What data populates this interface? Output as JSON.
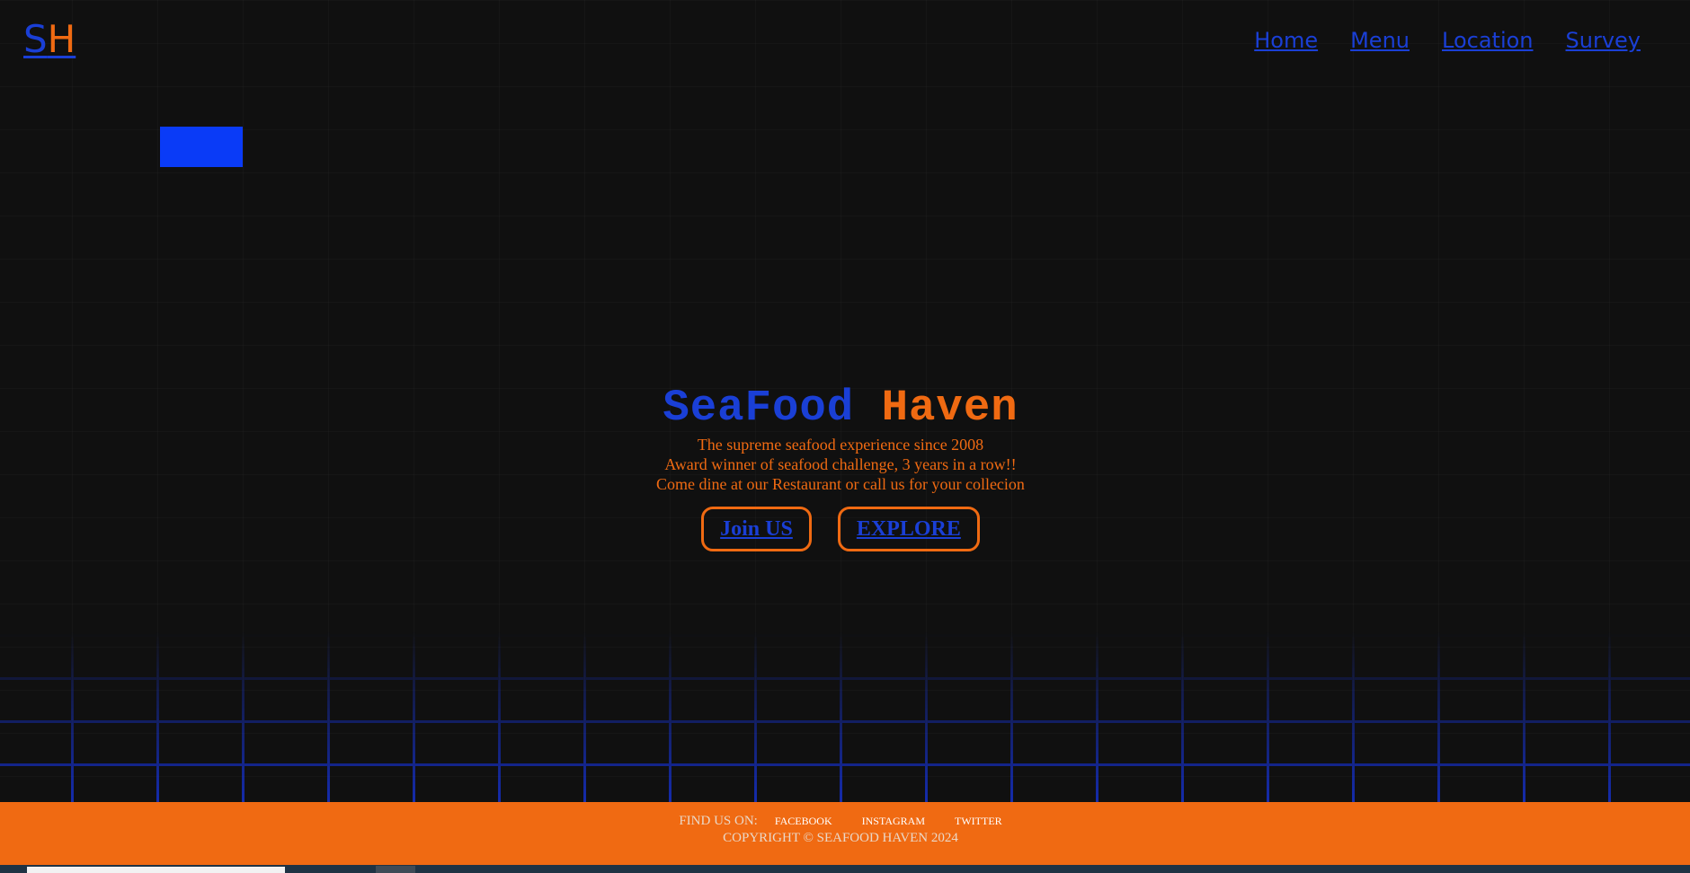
{
  "header": {
    "logo_s": "S",
    "logo_h": "H",
    "nav": [
      "Home",
      "Menu",
      "Location",
      "Survey"
    ]
  },
  "hero": {
    "title_part1": "SeaFood",
    "title_part2": "Haven",
    "taglines": [
      "The supreme seafood experience since 2008",
      "Award winner of seafood challenge, 3 years in a row!!",
      "Come dine at our Restaurant or call us for your collecion"
    ],
    "buttons": {
      "join": "Join US",
      "explore": "EXPLORE"
    }
  },
  "footer": {
    "find_us": "FIND US ON:",
    "social": [
      "FACEBOOK",
      "INSTAGRAM",
      "TWITTER"
    ],
    "copyright": "COPYRIGHT © SEAFOOD HAVEN 2024"
  },
  "colors": {
    "blue": "#1a3fd6",
    "orange": "#f06a12",
    "background": "#101010",
    "grid_glow": "#1530c8",
    "block_blue": "#0a3bf7"
  }
}
